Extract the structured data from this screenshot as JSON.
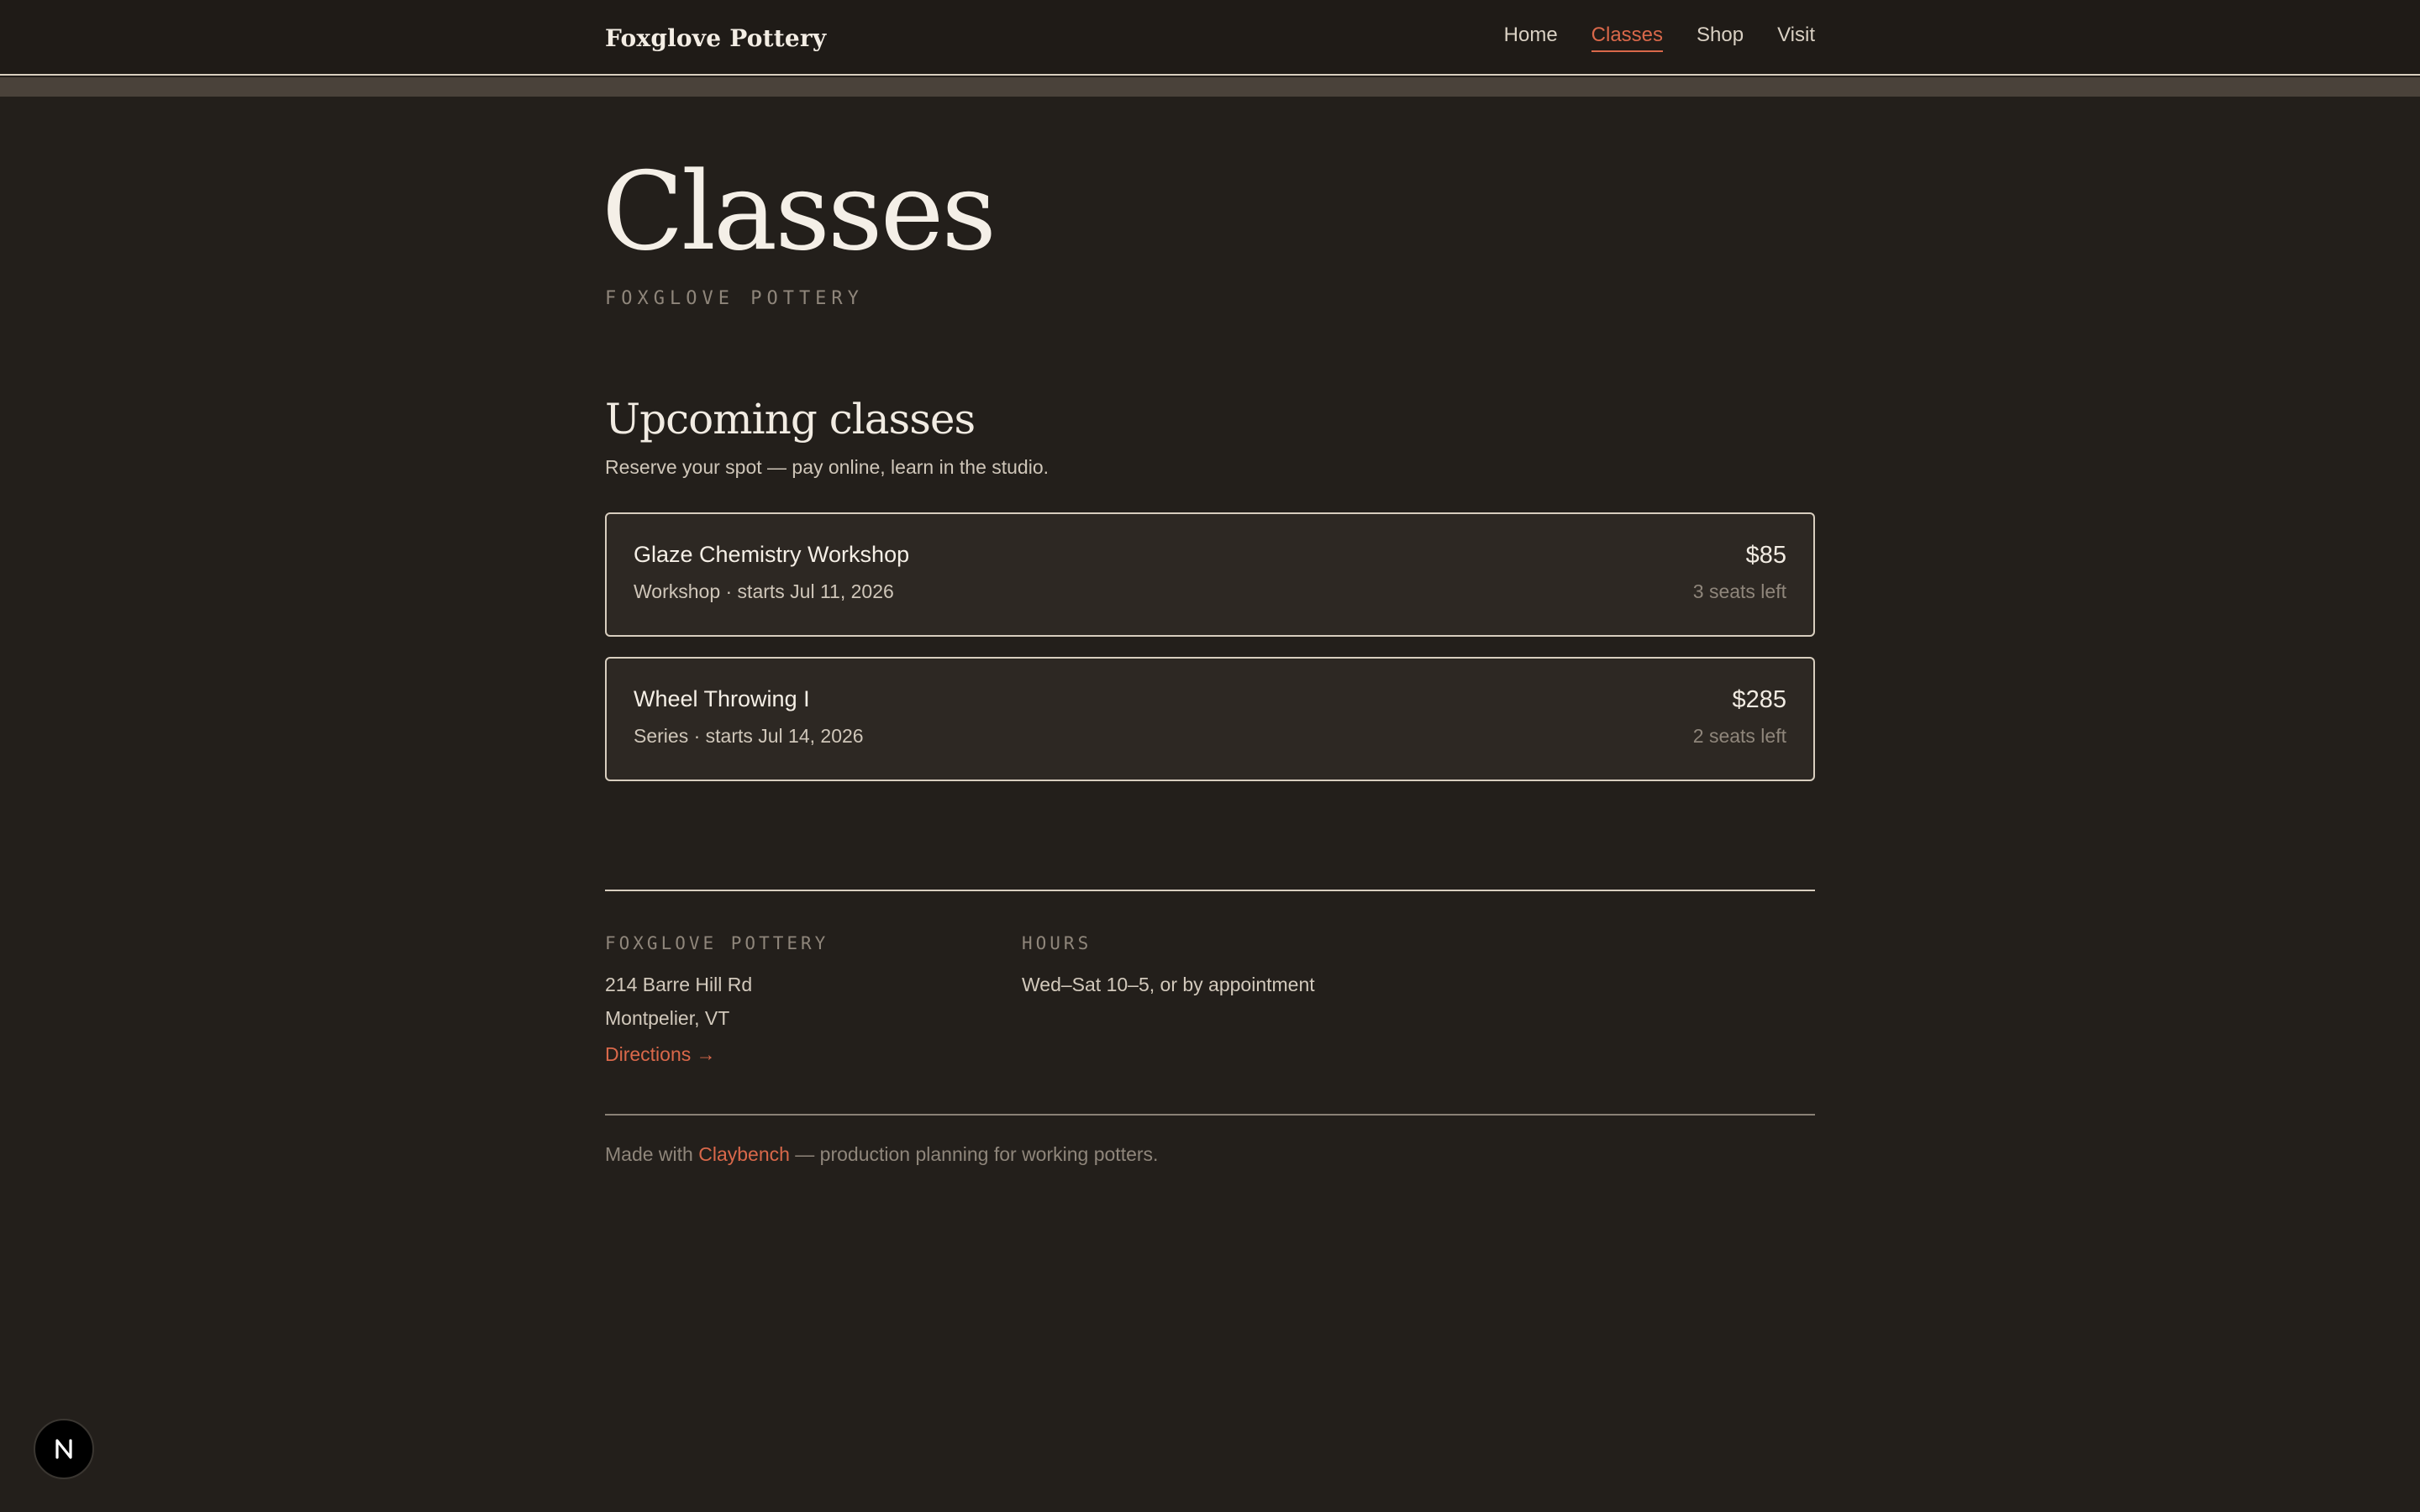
{
  "header": {
    "brand": "Foxglove Pottery",
    "nav": [
      {
        "label": "Home",
        "active": false
      },
      {
        "label": "Classes",
        "active": true
      },
      {
        "label": "Shop",
        "active": false
      },
      {
        "label": "Visit",
        "active": false
      }
    ]
  },
  "hero": {
    "title": "Classes",
    "subtitle": "FOXGLOVE POTTERY"
  },
  "upcoming": {
    "title": "Upcoming classes",
    "description": "Reserve your spot — pay online, learn in the studio.",
    "classes": [
      {
        "name": "Glaze Chemistry Workshop",
        "meta": "Workshop · starts Jul 11, 2026",
        "price": "$85",
        "seats": "3 seats left"
      },
      {
        "name": "Wheel Throwing I",
        "meta": "Series · starts Jul 14, 2026",
        "price": "$285",
        "seats": "2 seats left"
      }
    ]
  },
  "footer": {
    "studio_heading": "FOXGLOVE POTTERY",
    "address_line1": "214 Barre Hill Rd",
    "address_line2": "Montpelier, VT",
    "directions_label": "Directions →",
    "hours_heading": "HOURS",
    "hours_text": "Wed–Sat 10–5, or by appointment",
    "made_with_prefix": "Made with ",
    "made_with_link": "Claybench",
    "made_with_suffix": " — production planning for working potters."
  },
  "dev_badge": {
    "letter": "N",
    "icon": "next-logo-icon"
  },
  "colors": {
    "background": "#231f1b",
    "accent": "#d9684a",
    "card_border": "#d8cebf"
  }
}
